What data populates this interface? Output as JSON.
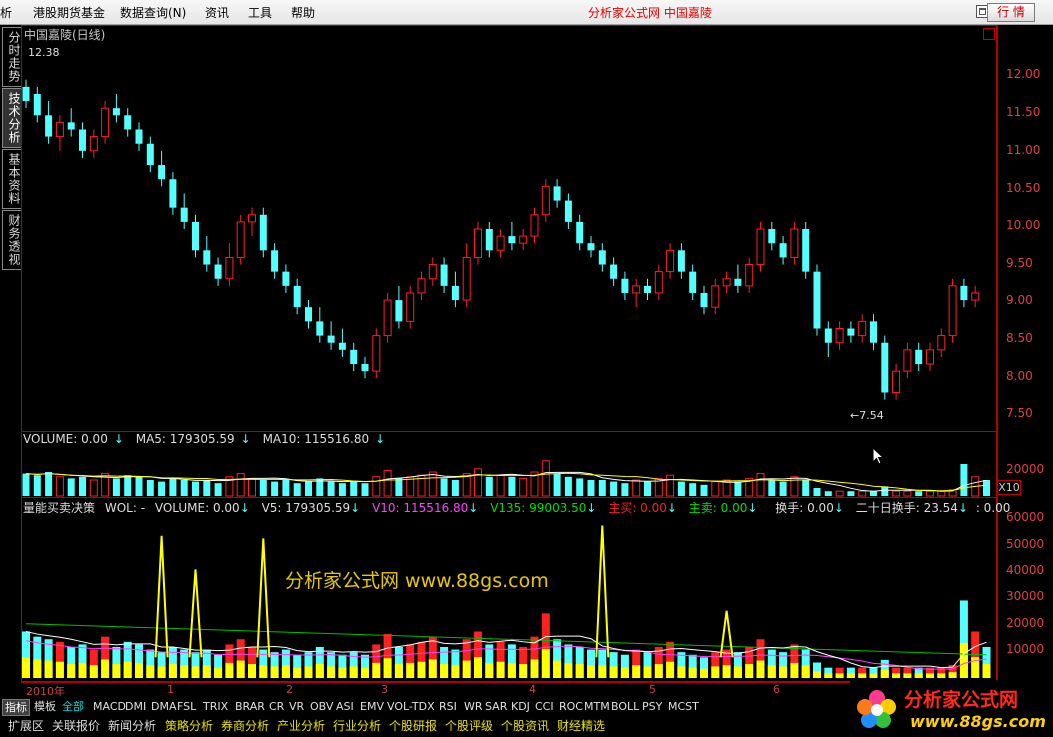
{
  "menubar": {
    "items": [
      "析",
      "港股期货基金",
      "数据查询(N)",
      "资讯",
      "工具",
      "帮助"
    ],
    "brand": "分析家公式网  中国嘉陵",
    "quote_button": "行 情"
  },
  "side_tabs": [
    "分时走势",
    "技术分析",
    "基本资料",
    "财务透视"
  ],
  "price_panel": {
    "title": "中国嘉陵(日线)",
    "high_marker": "12.38",
    "low_marker": "←7.54",
    "axis_labels": [
      "12.00",
      "11.50",
      "11.00",
      "10.50",
      "10.00",
      "9.50",
      "9.00",
      "8.50",
      "8.00",
      "7.50"
    ]
  },
  "volume_panel": {
    "label_volume": "VOLUME: 0.00",
    "label_ma5": "MA5: 179305.59",
    "label_ma10": "MA10: 115516.80",
    "axis_label": "20000",
    "multiplier": "X10"
  },
  "indicator_panel": {
    "name": "量能买卖决策",
    "label_wol": "WOL: -",
    "label_volume": "VOLUME: 0.00",
    "label_v5": "V5: 179305.59",
    "label_v10": "V10: 115516.80",
    "label_v135": "V135: 99003.50",
    "label_buy": "主买: 0.00",
    "label_sell": "主卖: 0.00",
    "label_turnover": "换手: 0.00",
    "label_turnover20": "二十日换手: 23.54",
    "label_extra": ": 0.00",
    "axis_labels": [
      "60000",
      "50000",
      "40000",
      "30000",
      "20000",
      "10000"
    ],
    "watermark": "分析家公式网 www.88gs.com"
  },
  "timeline": {
    "year_label": "2010年",
    "months": [
      "1",
      "2",
      "3",
      "4",
      "5",
      "6"
    ]
  },
  "indicator_tabs": [
    "指标",
    "模板",
    "全部",
    "MACD",
    "DMI",
    "DMA",
    "FSL",
    "TRIX",
    "BRAR",
    "CR",
    "VR",
    "OBV",
    "ASI",
    "EMV",
    "VOL-TDX",
    "RSI",
    "WR",
    "SAR",
    "KDJ",
    "CCI",
    "ROC",
    "MTM",
    "BOLL",
    "PSY",
    "MCST"
  ],
  "section_tabs": [
    "扩展区",
    "关联报价",
    "新闻分析",
    "策略分析",
    "券商分析",
    "产业分析",
    "行业分析",
    "个股研报",
    "个股评级",
    "个股资讯",
    "财经精选"
  ],
  "logo": {
    "text": "分析家公式网",
    "url": "www.88gs.com"
  },
  "colors": {
    "up": "#ff2020",
    "down": "#54ffff",
    "ma5": "#ffffff",
    "ma10": "#ffff00",
    "v135": "#00c000",
    "v10": "#ff40ff",
    "frame": "#b40000"
  },
  "chart_data": {
    "type": "candlestick",
    "price": {
      "ylim": [
        7.2,
        12.8
      ],
      "ohlc": [
        [
          12.0,
          12.1,
          11.7,
          11.8
        ],
        [
          11.9,
          12.0,
          11.5,
          11.6
        ],
        [
          11.6,
          11.8,
          11.2,
          11.3
        ],
        [
          11.3,
          11.6,
          11.1,
          11.5
        ],
        [
          11.5,
          11.7,
          11.3,
          11.4
        ],
        [
          11.4,
          11.5,
          11.0,
          11.1
        ],
        [
          11.1,
          11.4,
          11.0,
          11.3
        ],
        [
          11.3,
          11.8,
          11.2,
          11.7
        ],
        [
          11.7,
          11.9,
          11.5,
          11.6
        ],
        [
          11.6,
          11.7,
          11.3,
          11.4
        ],
        [
          11.4,
          11.5,
          11.1,
          11.2
        ],
        [
          11.2,
          11.3,
          10.8,
          10.9
        ],
        [
          10.9,
          11.1,
          10.6,
          10.7
        ],
        [
          10.7,
          10.8,
          10.2,
          10.3
        ],
        [
          10.3,
          10.5,
          10.0,
          10.1
        ],
        [
          10.1,
          10.2,
          9.6,
          9.7
        ],
        [
          9.7,
          9.9,
          9.4,
          9.5
        ],
        [
          9.5,
          9.6,
          9.2,
          9.3
        ],
        [
          9.3,
          9.8,
          9.2,
          9.6
        ],
        [
          9.6,
          10.2,
          9.5,
          10.1
        ],
        [
          10.1,
          10.3,
          9.9,
          10.2
        ],
        [
          10.2,
          10.3,
          9.6,
          9.7
        ],
        [
          9.7,
          9.8,
          9.3,
          9.4
        ],
        [
          9.4,
          9.5,
          9.1,
          9.2
        ],
        [
          9.2,
          9.3,
          8.8,
          8.9
        ],
        [
          8.9,
          9.0,
          8.6,
          8.7
        ],
        [
          8.7,
          8.9,
          8.4,
          8.5
        ],
        [
          8.5,
          8.7,
          8.3,
          8.4
        ],
        [
          8.4,
          8.6,
          8.2,
          8.3
        ],
        [
          8.3,
          8.4,
          8.0,
          8.1
        ],
        [
          8.1,
          8.2,
          7.9,
          8.0
        ],
        [
          8.0,
          8.6,
          7.9,
          8.5
        ],
        [
          8.5,
          9.1,
          8.4,
          9.0
        ],
        [
          9.0,
          9.2,
          8.6,
          8.7
        ],
        [
          8.7,
          9.2,
          8.6,
          9.1
        ],
        [
          9.1,
          9.4,
          9.0,
          9.3
        ],
        [
          9.3,
          9.6,
          9.2,
          9.5
        ],
        [
          9.5,
          9.6,
          9.1,
          9.2
        ],
        [
          9.2,
          9.4,
          8.9,
          9.0
        ],
        [
          9.0,
          9.8,
          8.9,
          9.6
        ],
        [
          9.6,
          10.1,
          9.5,
          10.0
        ],
        [
          10.0,
          10.1,
          9.6,
          9.7
        ],
        [
          9.7,
          10.0,
          9.6,
          9.9
        ],
        [
          9.9,
          10.1,
          9.7,
          9.8
        ],
        [
          9.8,
          10.0,
          9.7,
          9.9
        ],
        [
          9.9,
          10.3,
          9.8,
          10.2
        ],
        [
          10.2,
          10.7,
          10.1,
          10.6
        ],
        [
          10.6,
          10.7,
          10.3,
          10.4
        ],
        [
          10.4,
          10.5,
          10.0,
          10.1
        ],
        [
          10.1,
          10.2,
          9.7,
          9.8
        ],
        [
          9.8,
          9.9,
          9.6,
          9.7
        ],
        [
          9.7,
          9.8,
          9.4,
          9.5
        ],
        [
          9.5,
          9.6,
          9.2,
          9.3
        ],
        [
          9.3,
          9.4,
          9.0,
          9.1
        ],
        [
          9.1,
          9.3,
          8.9,
          9.2
        ],
        [
          9.2,
          9.3,
          9.0,
          9.1
        ],
        [
          9.1,
          9.5,
          9.0,
          9.4
        ],
        [
          9.4,
          9.8,
          9.3,
          9.7
        ],
        [
          9.7,
          9.8,
          9.3,
          9.4
        ],
        [
          9.4,
          9.5,
          9.0,
          9.1
        ],
        [
          9.1,
          9.2,
          8.8,
          8.9
        ],
        [
          8.9,
          9.3,
          8.8,
          9.2
        ],
        [
          9.2,
          9.4,
          9.1,
          9.3
        ],
        [
          9.3,
          9.5,
          9.1,
          9.2
        ],
        [
          9.2,
          9.6,
          9.1,
          9.5
        ],
        [
          9.5,
          10.1,
          9.4,
          10.0
        ],
        [
          10.0,
          10.1,
          9.7,
          9.8
        ],
        [
          9.8,
          9.9,
          9.5,
          9.6
        ],
        [
          9.6,
          10.1,
          9.5,
          10.0
        ],
        [
          10.0,
          10.1,
          9.3,
          9.4
        ],
        [
          9.4,
          9.5,
          8.5,
          8.6
        ],
        [
          8.6,
          8.7,
          8.2,
          8.4
        ],
        [
          8.4,
          8.7,
          8.3,
          8.6
        ],
        [
          8.6,
          8.7,
          8.4,
          8.5
        ],
        [
          8.5,
          8.8,
          8.4,
          8.7
        ],
        [
          8.7,
          8.8,
          8.3,
          8.4
        ],
        [
          8.4,
          8.5,
          7.6,
          7.7
        ],
        [
          7.7,
          8.1,
          7.6,
          8.0
        ],
        [
          8.0,
          8.4,
          7.9,
          8.3
        ],
        [
          8.3,
          8.4,
          8.0,
          8.1
        ],
        [
          8.1,
          8.4,
          8.0,
          8.3
        ],
        [
          8.3,
          8.6,
          8.2,
          8.5
        ],
        [
          8.5,
          9.3,
          8.4,
          9.2
        ],
        [
          9.2,
          9.3,
          8.9,
          9.0
        ],
        [
          9.0,
          9.2,
          8.9,
          9.1
        ]
      ]
    },
    "volume": {
      "ylim": [
        0,
        30000
      ],
      "values": [
        14000,
        13000,
        15000,
        12000,
        11000,
        12000,
        10000,
        14000,
        11000,
        13000,
        12000,
        10000,
        9000,
        11000,
        10000,
        9000,
        10000,
        8000,
        12000,
        14000,
        11000,
        10000,
        9000,
        10000,
        8000,
        9000,
        11000,
        9000,
        8000,
        9000,
        8000,
        12000,
        16000,
        11000,
        12000,
        13000,
        15000,
        11000,
        10000,
        14000,
        17000,
        12000,
        13000,
        12000,
        11000,
        15000,
        22000,
        14000,
        12000,
        11000,
        10000,
        10000,
        9000,
        8000,
        10000,
        9000,
        11000,
        13000,
        9000,
        8000,
        7000,
        9000,
        10000,
        9000,
        11000,
        14000,
        10000,
        9000,
        12000,
        10000,
        5000,
        3000,
        3000,
        3000,
        3000,
        3000,
        6000,
        3000,
        3000,
        3000,
        3000,
        3000,
        4000,
        20000,
        12000,
        10000
      ]
    },
    "indicator": {
      "ylim": [
        0,
        65000
      ],
      "values": [
        18000,
        16000,
        15000,
        14000,
        12000,
        13000,
        11000,
        16000,
        12000,
        14000,
        13000,
        11000,
        10000,
        12000,
        11000,
        10000,
        11000,
        9000,
        13000,
        15000,
        12000,
        11000,
        10000,
        11000,
        9000,
        10000,
        12000,
        10000,
        9000,
        10000,
        9000,
        13000,
        17000,
        12000,
        13000,
        14000,
        16000,
        12000,
        11000,
        15000,
        18000,
        13000,
        14000,
        13000,
        12000,
        16000,
        25000,
        15000,
        13000,
        12000,
        11000,
        11000,
        10000,
        9000,
        11000,
        10000,
        12000,
        14000,
        10000,
        9000,
        8000,
        10000,
        11000,
        10000,
        12000,
        15000,
        11000,
        10000,
        13000,
        11000,
        6000,
        4000,
        4000,
        4000,
        4000,
        4000,
        7000,
        4000,
        4000,
        4000,
        4000,
        4000,
        5000,
        30000,
        18000,
        12000
      ],
      "spikes": [
        [
          12,
          55000
        ],
        [
          15,
          42000
        ],
        [
          21,
          54000
        ],
        [
          51,
          59000
        ],
        [
          62,
          26000
        ]
      ],
      "v135": [
        21000,
        9000
      ]
    }
  }
}
